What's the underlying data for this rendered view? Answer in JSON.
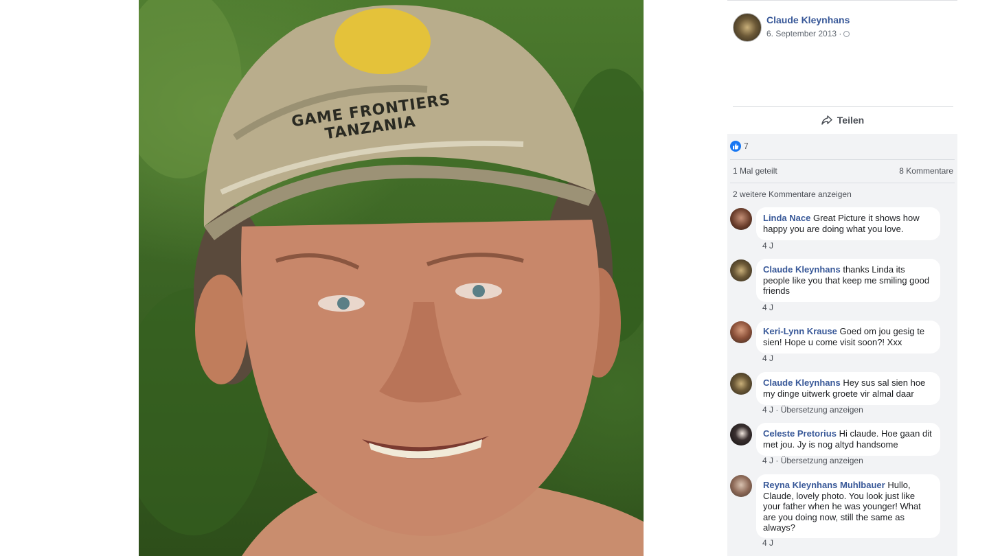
{
  "post": {
    "author": "Claude Kleynhans",
    "date": "6. September 2013 ·",
    "photo_cap_line1": "GAME FRONTIERS",
    "photo_cap_line2": "TANZANIA"
  },
  "actions": {
    "share_label": "Teilen"
  },
  "stats": {
    "likes": "7",
    "shares": "1 Mal geteilt",
    "comments": "8 Kommentare",
    "more_comments": "2 weitere Kommentare anzeigen"
  },
  "comments": [
    {
      "name": "Linda Nace",
      "text": "Great Picture it shows how happy you are doing what you love.",
      "age": "4 J",
      "translate": ""
    },
    {
      "name": "Claude Kleynhans",
      "text": "thanks Linda its people like you that keep me smiling good friends",
      "age": "4 J",
      "translate": ""
    },
    {
      "name": "Keri-Lynn Krause",
      "text": "Goed om jou gesig te sien! Hope u come visit soon?! Xxx",
      "age": "4 J",
      "translate": ""
    },
    {
      "name": "Claude Kleynhans",
      "text": "Hey sus sal sien hoe my dinge uitwerk groete vir almal daar",
      "age": "4 J ·",
      "translate": "Übersetzung anzeigen"
    },
    {
      "name": "Celeste Pretorius",
      "text": "Hi claude. Hoe gaan dit met jou. Jy is nog altyd handsome",
      "age": "4 J ·",
      "translate": "Übersetzung anzeigen"
    },
    {
      "name": "Reyna Kleynhans Muhlbauer",
      "text": "Hullo, Claude, lovely photo. You look just like your father when he was younger! What are you doing now, still the same as always?",
      "age": "4 J",
      "translate": ""
    }
  ],
  "colors": {
    "link_blue": "#385898",
    "panel_bg": "#f2f3f5",
    "like_blue": "#1877f2"
  }
}
